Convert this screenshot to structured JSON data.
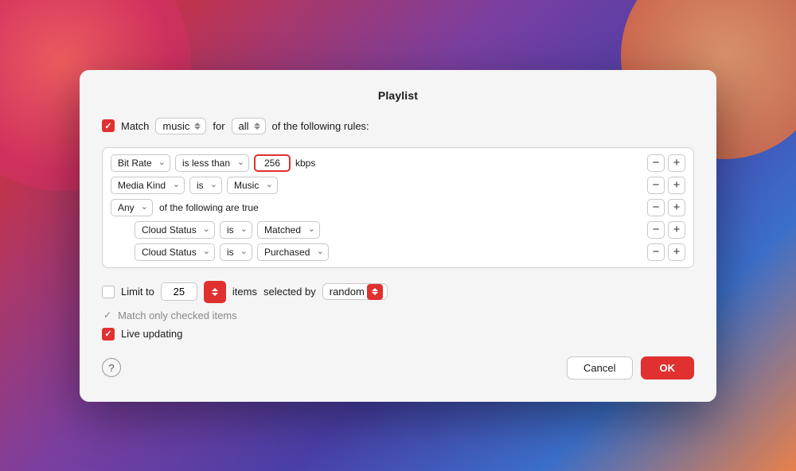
{
  "background": {
    "gradient": "135deg, #e63a5a 0%, #c0334d 15%, #7b3fa0 40%, #4a3fa8 60%, #3b6fc9 80%"
  },
  "dialog": {
    "title": "Playlist",
    "match_label": "Match",
    "match_for_label": "for",
    "match_of_label": "of the following rules:",
    "match_music_value": "music",
    "match_all_value": "all",
    "rules": [
      {
        "field": "Bit Rate",
        "condition": "is less than",
        "value": "256",
        "unit": "kbps"
      },
      {
        "field": "Media Kind",
        "condition": "is",
        "value": "Music"
      },
      {
        "field": "Any",
        "sub_label": "of the following are true",
        "sub_rules": [
          {
            "field": "Cloud Status",
            "condition": "is",
            "value": "Matched"
          },
          {
            "field": "Cloud Status",
            "condition": "is",
            "value": "Purchased"
          }
        ]
      }
    ],
    "limit_label": "Limit to",
    "limit_value": "25",
    "items_label": "items",
    "selected_by_label": "selected by",
    "selected_by_value": "random",
    "match_only_checked": "Match only checked items",
    "live_updating_label": "Live updating",
    "cancel_label": "Cancel",
    "ok_label": "OK",
    "help_label": "?"
  }
}
